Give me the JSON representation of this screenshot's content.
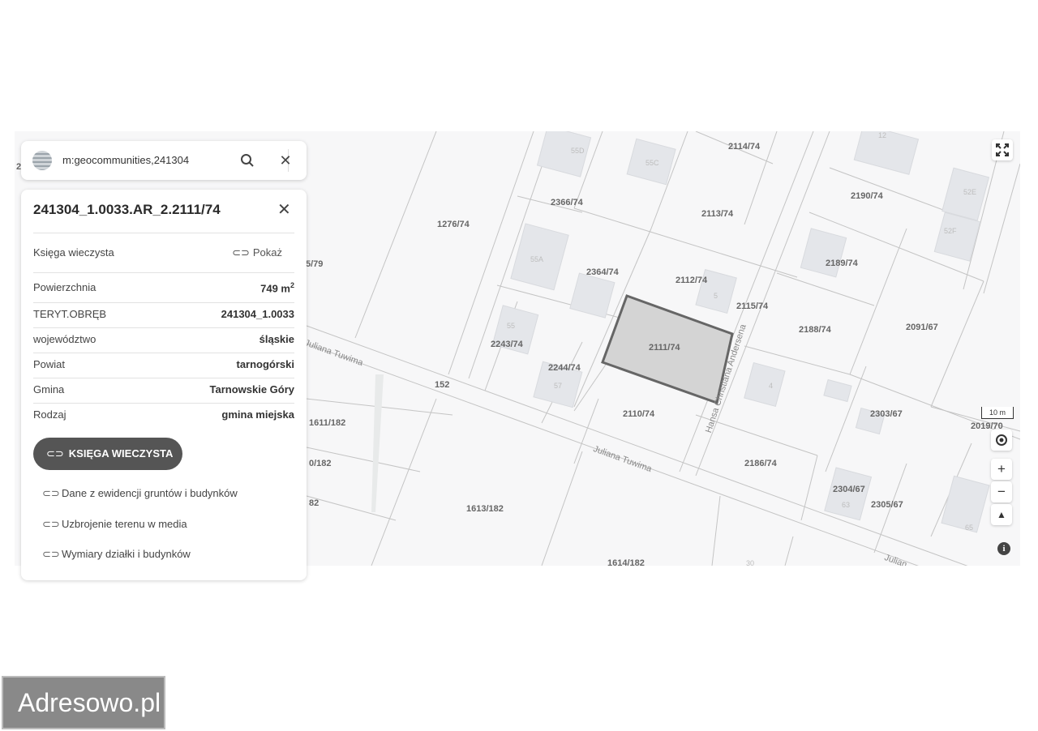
{
  "search": {
    "query": "m:geocommunities,241304"
  },
  "panel": {
    "title": "241304_1.0033.AR_2.2111/74",
    "kw_row": {
      "label": "Księga wieczysta",
      "action": "Pokaż"
    },
    "fields": [
      {
        "label": "Powierzchnia",
        "value": "749 m",
        "sup": "2"
      },
      {
        "label": "TERYT.OBRĘB",
        "value": "241304_1.0033"
      },
      {
        "label": "województwo",
        "value": "śląskie"
      },
      {
        "label": "Powiat",
        "value": "tarnogórski"
      },
      {
        "label": "Gmina",
        "value": "Tarnowskie Góry"
      },
      {
        "label": "Rodzaj",
        "value": "gmina miejska"
      }
    ],
    "button_label": "KSIĘGA WIECZYSTA",
    "links": [
      "Dane z ewidencji gruntów i budynków",
      "Uzbrojenie terenu w media",
      "Wymiary działki i budynków"
    ]
  },
  "map": {
    "parcels": [
      "2114/74",
      "2366/74",
      "1276/74",
      "2113/74",
      "2190/74",
      "2189/74",
      "2364/74",
      "2112/74",
      "2115/74",
      "2188/74",
      "2091/67",
      "2243/74",
      "2111/74",
      "2244/74",
      "152",
      "2110/74",
      "2303/67",
      "2186/74",
      "2304/67",
      "2305/67",
      "1613/182",
      "1614/182",
      "1611/182",
      "0/182",
      "82",
      "5/79",
      "2019/70"
    ],
    "buildings": [
      "55D",
      "55C",
      "55A",
      "55",
      "57",
      "5",
      "4",
      "52E",
      "52F",
      "63",
      "65",
      "12",
      "30"
    ],
    "streets": [
      "Juliana Tuwima",
      "Juliana Tuwima",
      "Hansa Christiana Andersena",
      "Julian"
    ],
    "edge_label": "2",
    "scale": "10 m",
    "selected_fill": "#d4d4d4",
    "selected_stroke": "#666666"
  },
  "watermark": "Adresowo.pl",
  "icons": {
    "search": "magnifier",
    "close": "x",
    "fullscreen": "expand-arrows",
    "locate": "target",
    "zoom_in": "plus",
    "zoom_out": "minus",
    "north": "compass",
    "info": "i-circle",
    "link": "chain"
  }
}
